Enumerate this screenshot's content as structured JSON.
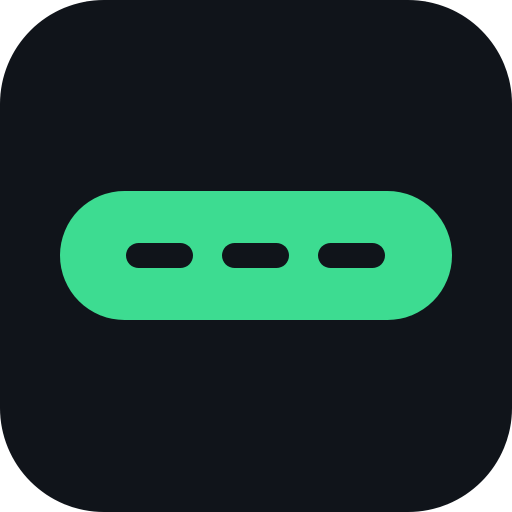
{
  "icon": {
    "semantic": "password-dots-icon",
    "colors": {
      "background": "#10141A",
      "pill": "#3DDC91",
      "dash": "#10141A"
    },
    "dash_count": 3
  }
}
